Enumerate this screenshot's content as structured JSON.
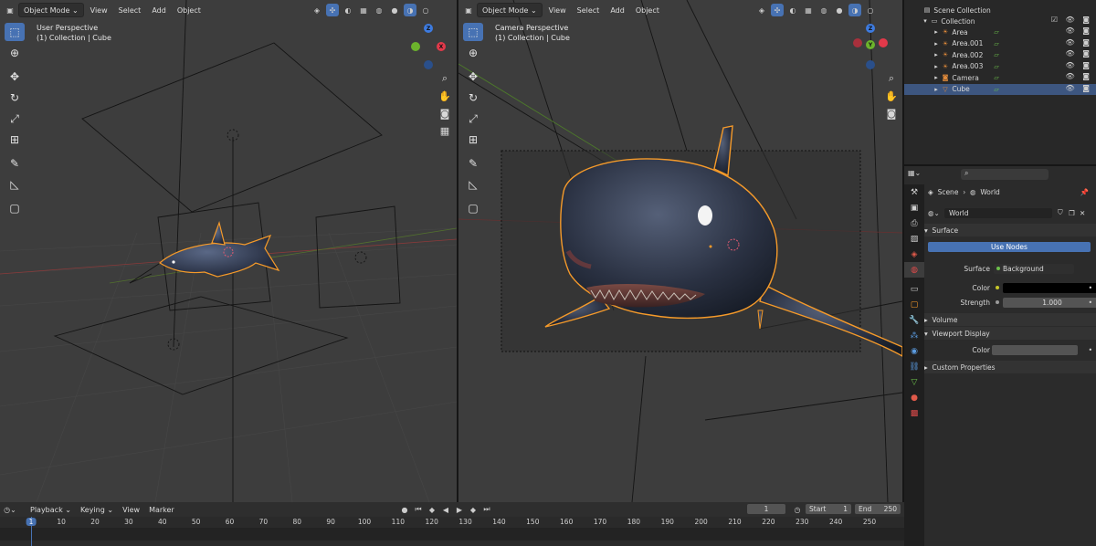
{
  "left_viewport": {
    "mode": "Object Mode",
    "menu": [
      "View",
      "Select",
      "Add",
      "Object"
    ],
    "perspective": "User Perspective",
    "context": "(1) Collection | Cube"
  },
  "right_viewport": {
    "mode": "Object Mode",
    "menu": [
      "View",
      "Select",
      "Add",
      "Object"
    ],
    "perspective": "Camera Perspective",
    "context": "(1) Collection | Cube"
  },
  "gizmo": {
    "x": "X",
    "y": "Y",
    "z": "Z"
  },
  "outliner": {
    "root": "Scene Collection",
    "collection": "Collection",
    "items": [
      {
        "name": "Area",
        "type": "light",
        "selected": false
      },
      {
        "name": "Area.001",
        "type": "light",
        "selected": false
      },
      {
        "name": "Area.002",
        "type": "light",
        "selected": false
      },
      {
        "name": "Area.003",
        "type": "light",
        "selected": false
      },
      {
        "name": "Camera",
        "type": "camera",
        "selected": false
      },
      {
        "name": "Cube",
        "type": "mesh",
        "selected": true
      }
    ]
  },
  "properties": {
    "scene_label": "Scene",
    "world_label": "World",
    "world_name": "World",
    "surface_panel": "Surface",
    "use_nodes": "Use Nodes",
    "surface_label": "Surface",
    "surface_value": "Background",
    "color_label": "Color",
    "color_value": "#000000",
    "strength_label": "Strength",
    "strength_value": "1.000",
    "volume_panel": "Volume",
    "viewport_display_panel": "Viewport Display",
    "vd_color_label": "Color",
    "custom_props_panel": "Custom Properties"
  },
  "timeline": {
    "menu": [
      "Playback",
      "Keying",
      "View",
      "Marker"
    ],
    "current_frame": "1",
    "start_label": "Start",
    "start_value": "1",
    "end_label": "End",
    "end_value": "250",
    "ticks": [
      "1",
      "10",
      "20",
      "30",
      "40",
      "50",
      "60",
      "70",
      "80",
      "90",
      "100",
      "110",
      "120",
      "130",
      "140",
      "150",
      "160",
      "170",
      "180",
      "190",
      "200",
      "210",
      "220",
      "230",
      "240",
      "250"
    ]
  },
  "colors": {
    "accent": "#4772b3",
    "selection_outline": "#f59a2a",
    "x_axis": "#e2394a",
    "y_axis": "#6cb32c",
    "z_axis": "#3d7be0"
  }
}
